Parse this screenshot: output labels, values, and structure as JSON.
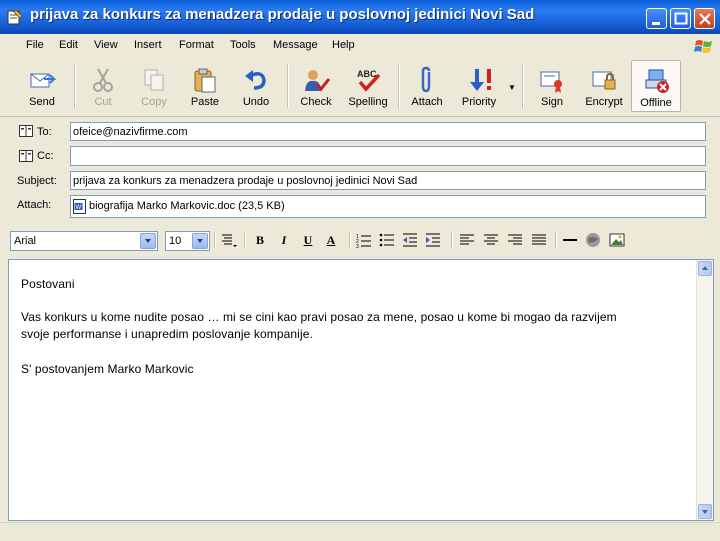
{
  "window": {
    "title": "prijava za konkurs za menadzera prodaje u poslovnoj jedinici Novi Sad",
    "controls": [
      "minimize-icon",
      "maximize-icon",
      "close-icon"
    ]
  },
  "menu": {
    "items": [
      "File",
      "Edit",
      "View",
      "Insert",
      "Format",
      "Tools",
      "Message",
      "Help"
    ]
  },
  "toolbar": {
    "send": "Send",
    "cut": "Cut",
    "copy": "Copy",
    "paste": "Paste",
    "undo": "Undo",
    "check": "Check",
    "spelling": "Spelling",
    "attach": "Attach",
    "priority": "Priority",
    "sign": "Sign",
    "encrypt": "Encrypt",
    "offline": "Offline",
    "spelling_icon_text": "ABC"
  },
  "header": {
    "to_label": "To:",
    "to_value": "ofeice@nazivfirme.com",
    "cc_label": "Cc:",
    "cc_value": "",
    "subject_label": "Subject:",
    "subject_value": "prijava za konkurs za menadzera prodaje u poslovnoj jedinici Novi Sad",
    "attach_label": "Attach:",
    "attachment": "biografija Marko Markovic.doc (23,5 KB)"
  },
  "format": {
    "font": "Arial",
    "size": "10",
    "bold": "B",
    "italic": "I",
    "underline": "U",
    "font_color": "A"
  },
  "body": {
    "greeting": "Postovani",
    "line1": "Vas konkurs u kome nudite posao … mi se cini kao pravi posao za mene, posao u kome bi mogao da razvijem",
    "line2": "svoje performanse i unapredim poslovanje kompanije.",
    "signature": "S' postovanjem Marko Markovic"
  },
  "colors": {
    "titlebar": "#0a5fd8",
    "chrome": "#ece9d8",
    "field_border": "#7f9db9"
  }
}
